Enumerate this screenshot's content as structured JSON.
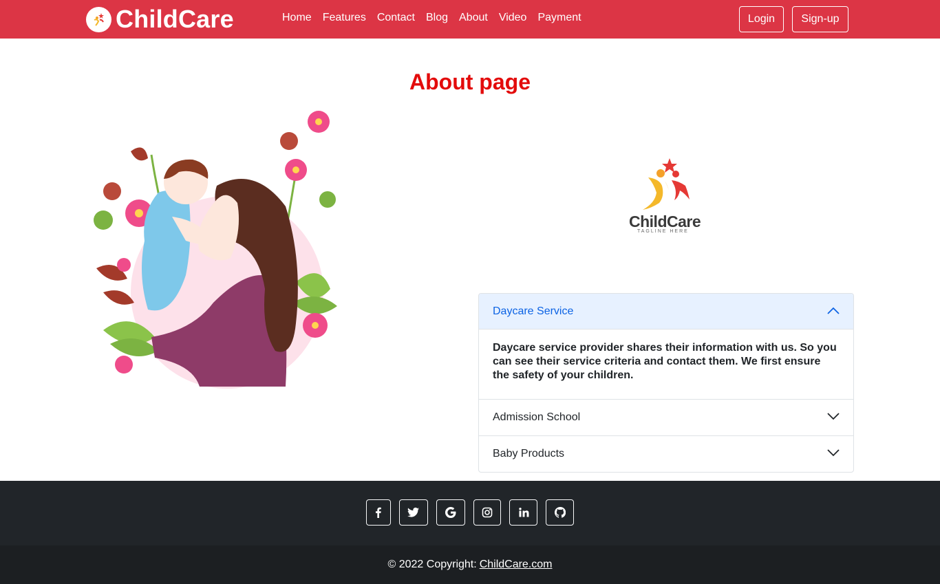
{
  "navbar": {
    "brand": "ChildCare",
    "brand_logo_icon": "childcare-logo-icon",
    "links": [
      "Home",
      "Features",
      "Contact",
      "Blog",
      "About",
      "Video",
      "Payment"
    ],
    "login": "Login",
    "signup": "Sign-up"
  },
  "page": {
    "title": "About page"
  },
  "logo": {
    "word": "ChildCare",
    "tagline": "TAGLINE HERE"
  },
  "accordion": {
    "items": [
      {
        "label": "Daycare Service",
        "open": true,
        "body": "Daycare service provider shares their information with us. So you can see their service criteria and contact them. We first ensure the safety of your children."
      },
      {
        "label": "Admission School",
        "open": false
      },
      {
        "label": "Baby Products",
        "open": false
      }
    ]
  },
  "footer": {
    "social_icons": [
      "facebook-icon",
      "twitter-icon",
      "google-icon",
      "instagram-icon",
      "linkedin-icon",
      "github-icon"
    ],
    "copyright_text": "© 2022 Copyright:",
    "copyright_link": "ChildCare.com"
  },
  "colors": {
    "navbar": "#dc3545",
    "title": "#e30b0b",
    "accordion_active_bg": "#e7f1ff",
    "accordion_active_text": "#0c63e4",
    "footer": "#212529"
  }
}
